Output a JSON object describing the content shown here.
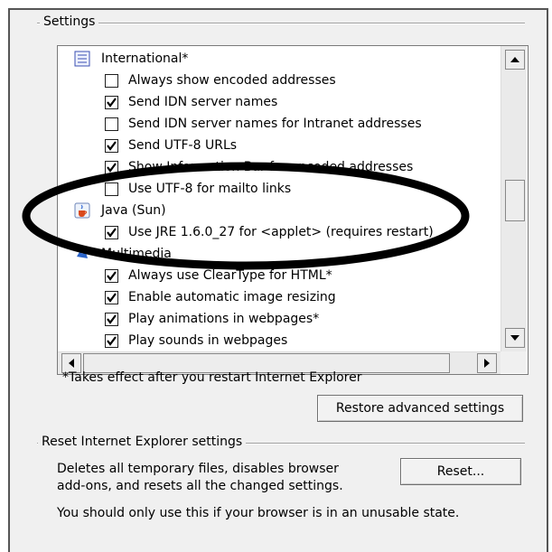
{
  "settings": {
    "group_label": "Settings",
    "tree": [
      {
        "type": "category",
        "icon": "document-icon",
        "label": "International*"
      },
      {
        "type": "option",
        "checked": false,
        "label": "Always show encoded addresses"
      },
      {
        "type": "option",
        "checked": true,
        "label": "Send IDN server names"
      },
      {
        "type": "option",
        "checked": false,
        "label": "Send IDN server names for Intranet addresses"
      },
      {
        "type": "option",
        "checked": true,
        "label": "Send UTF-8 URLs"
      },
      {
        "type": "option",
        "checked": true,
        "label": "Show Information Bar for encoded addresses"
      },
      {
        "type": "option",
        "checked": false,
        "label": "Use UTF-8 for mailto links"
      },
      {
        "type": "category",
        "icon": "java-cup-icon",
        "label": "Java (Sun)"
      },
      {
        "type": "option",
        "checked": true,
        "label": "Use JRE 1.6.0_27 for <applet> (requires restart)"
      },
      {
        "type": "category",
        "icon": "multimedia-icon",
        "label": "Multimedia"
      },
      {
        "type": "option",
        "checked": true,
        "label": "Always use ClearType for HTML*"
      },
      {
        "type": "option",
        "checked": true,
        "label": "Enable automatic image resizing"
      },
      {
        "type": "option",
        "checked": true,
        "label": "Play animations in webpages*"
      },
      {
        "type": "option",
        "checked": true,
        "label": "Play sounds in webpages"
      }
    ],
    "restart_note": "*Takes effect after you restart Internet Explorer",
    "restore_button": "Restore advanced settings"
  },
  "reset": {
    "group_label": "Reset Internet Explorer settings",
    "description_line1": "Deletes all temporary files, disables browser",
    "description_line2": "add-ons, and resets all the changed settings.",
    "reset_button": "Reset...",
    "warning": "You should only use this if your browser is in an unusable state."
  },
  "annotation": {
    "shape": "ellipse",
    "color": "#000000"
  }
}
